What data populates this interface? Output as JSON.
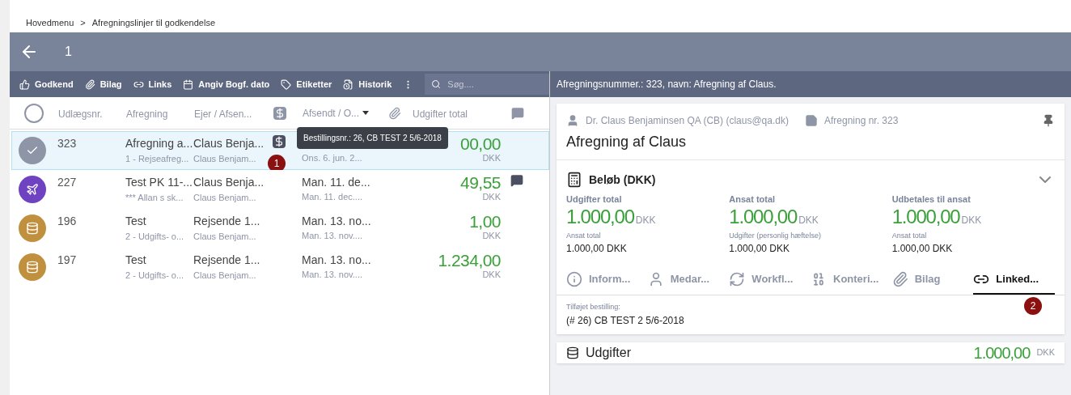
{
  "breadcrumb": [
    {
      "label": "Hovedmenu"
    },
    {
      "label": ">"
    },
    {
      "label": "Afregningslinjer til godkendelse"
    }
  ],
  "header": {
    "count": "1"
  },
  "toolbar": [
    {
      "kind": "approve",
      "label": "Godkend"
    },
    {
      "kind": "attach",
      "label": "Bilag"
    },
    {
      "kind": "link",
      "label": "Links"
    },
    {
      "kind": "calendar",
      "label": "Angiv Bogf. dato"
    },
    {
      "kind": "tag",
      "label": "Etiketter"
    },
    {
      "kind": "history",
      "label": "Historik"
    },
    {
      "kind": "more"
    }
  ],
  "search": {
    "placeholder": "Søg...."
  },
  "select_all": {
    "checked": false
  },
  "columns": [
    {
      "kind": "text",
      "label": "Udlægsnr."
    },
    {
      "kind": "text",
      "label": "Afregning"
    },
    {
      "kind": "text",
      "label": "Ejer / Afsen..."
    },
    {
      "kind": "order"
    },
    {
      "kind": "sort",
      "label": "Afsendt / O..."
    },
    {
      "kind": "attach"
    },
    {
      "kind": "text",
      "label": "Udgifter total"
    },
    {
      "kind": "comment"
    }
  ],
  "rows": [
    {
      "selected": true,
      "kind": "check",
      "color": "#8e95a6",
      "number": "323",
      "title": "Afregning a...",
      "subtitle": "1 - Rejseafreg...",
      "owner": "Claus Benja...",
      "owner_sub": "Claus Benjam...",
      "order_icon": true,
      "date": "",
      "date_sub": "Ons. 6. jun. 2...",
      "amount": "00,00",
      "currency": "DKK",
      "comment": false
    },
    {
      "selected": false,
      "kind": "plane",
      "color": "#6f42c1",
      "number": "227",
      "title": "Test PK 11-...",
      "subtitle": "*** Allan s sk...",
      "owner": "Claus Benja...",
      "owner_sub": "Claus Benjam...",
      "order_icon": false,
      "date": "Man. 11. de...",
      "date_sub": "Man. 11. dec....",
      "amount": "49,55",
      "currency": "DKK",
      "comment": true
    },
    {
      "selected": false,
      "kind": "coins",
      "color": "#c0903f",
      "number": "196",
      "title": "Test",
      "subtitle": "2 - Udgifts- o...",
      "owner": "Rejsende 1...",
      "owner_sub": "Claus Benjam...",
      "order_icon": false,
      "date": "Man. 13. no...",
      "date_sub": "Man. 13. nov....",
      "amount": "1,00",
      "currency": "DKK",
      "comment": false
    },
    {
      "selected": false,
      "kind": "coins",
      "color": "#c0903f",
      "number": "197",
      "title": "Test",
      "subtitle": "2 - Udgifts- o...",
      "owner": "Rejsende 1...",
      "owner_sub": "Claus Benjam...",
      "order_icon": false,
      "date": "Man. 13. no...",
      "date_sub": "Man. 13. nov....",
      "amount": "1.234,00",
      "currency": "DKK",
      "comment": false
    }
  ],
  "tooltip": {
    "text": "Bestillingsnr.: 26, CB TEST 2 5/6-2018",
    "marker": "1"
  },
  "detail": {
    "header": "Afregningsnummer.: 323, navn: Afregning af Claus.",
    "owner": "Dr. Claus Benjaminsen QA (CB) (claus@qa.dk)",
    "ref": "Afregning nr. 323",
    "title": "Afregning af Claus",
    "amounts": {
      "title": "Beløb (DKK)",
      "expanded": true,
      "items": [
        {
          "label": "Udgifter total",
          "amount": "1.000,00",
          "currency": "DKK",
          "sublabel": "Ansat total",
          "subvalue": "1.000,00 DKK"
        },
        {
          "label": "Ansat total",
          "amount": "1.000,00",
          "currency": "DKK",
          "sublabel": "Udgifter (personlig hæftelse)",
          "subvalue": "1.000,00 DKK"
        },
        {
          "label": "Udbetales til ansat",
          "amount": "1.000,00",
          "currency": "DKK",
          "sublabel": "Ansat total",
          "subvalue": "1.000,00 DKK"
        }
      ]
    },
    "tabs": [
      {
        "kind": "info",
        "label": "Inform...",
        "selected": false
      },
      {
        "kind": "person",
        "label": "Medar...",
        "selected": false
      },
      {
        "kind": "workflow",
        "label": "Workfl...",
        "selected": false
      },
      {
        "kind": "binary",
        "label": "Konteri...",
        "selected": false
      },
      {
        "kind": "attach",
        "label": "Bilag",
        "selected": false
      },
      {
        "kind": "link",
        "label": "Linked...",
        "selected": true
      }
    ],
    "tab_marker": "2",
    "linked": {
      "label": "Tilføjet bestilling:",
      "value": "(# 26) CB TEST 2 5/6-2018"
    },
    "expenses": {
      "title": "Udgifter",
      "amount": "1.000,00",
      "currency": "DKK"
    }
  }
}
